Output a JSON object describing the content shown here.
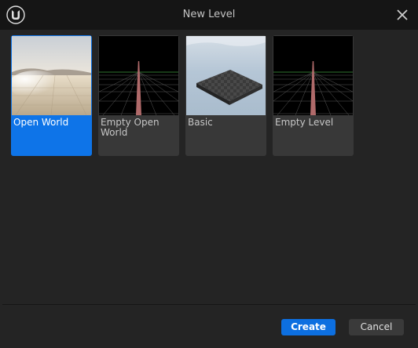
{
  "window": {
    "title": "New Level"
  },
  "icons": {
    "logo": "unreal-engine-logo",
    "close": "close-icon"
  },
  "templates": [
    {
      "label": "Open World",
      "selected": true
    },
    {
      "label": "Empty Open World",
      "selected": false
    },
    {
      "label": "Basic",
      "selected": false
    },
    {
      "label": "Empty Level",
      "selected": false
    }
  ],
  "footer": {
    "create_label": "Create",
    "cancel_label": "Cancel"
  },
  "colors": {
    "accent": "#0e74e8",
    "titlebar": "#151515",
    "background": "#242424",
    "tile": "#383838"
  }
}
